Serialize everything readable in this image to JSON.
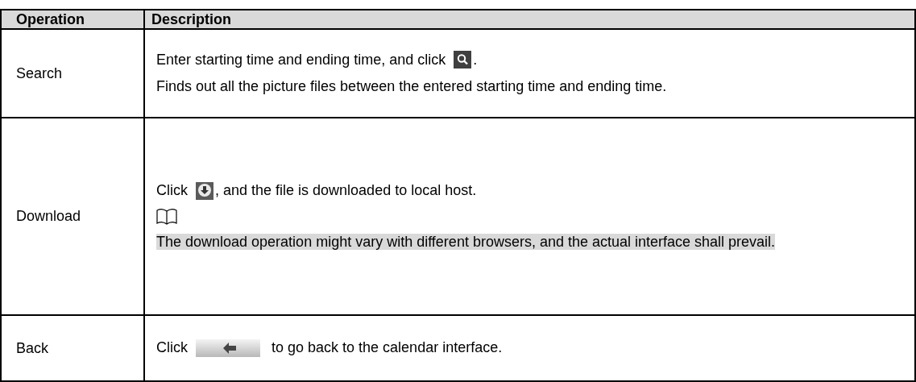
{
  "table": {
    "columns": [
      "Operation",
      "Description"
    ],
    "rows": [
      {
        "operation": "Search",
        "paragraphs": [
          {
            "kind": "search_line",
            "before": "Enter starting time and ending time, and click",
            "after": "."
          },
          {
            "kind": "text",
            "text": "Finds out all the picture files between the entered starting time and ending time."
          }
        ]
      },
      {
        "operation": "Download",
        "paragraphs": [
          {
            "kind": "download_line",
            "before": "Click",
            "after": ", and the file is downloaded to local host."
          },
          {
            "kind": "note_icon"
          },
          {
            "kind": "note",
            "text": "The download operation might vary with different browsers, and the actual interface shall prevail."
          }
        ]
      },
      {
        "operation": "Back",
        "paragraphs": [
          {
            "kind": "back_line",
            "before": "Click",
            "after": "to go back to the calendar interface."
          }
        ]
      }
    ]
  }
}
